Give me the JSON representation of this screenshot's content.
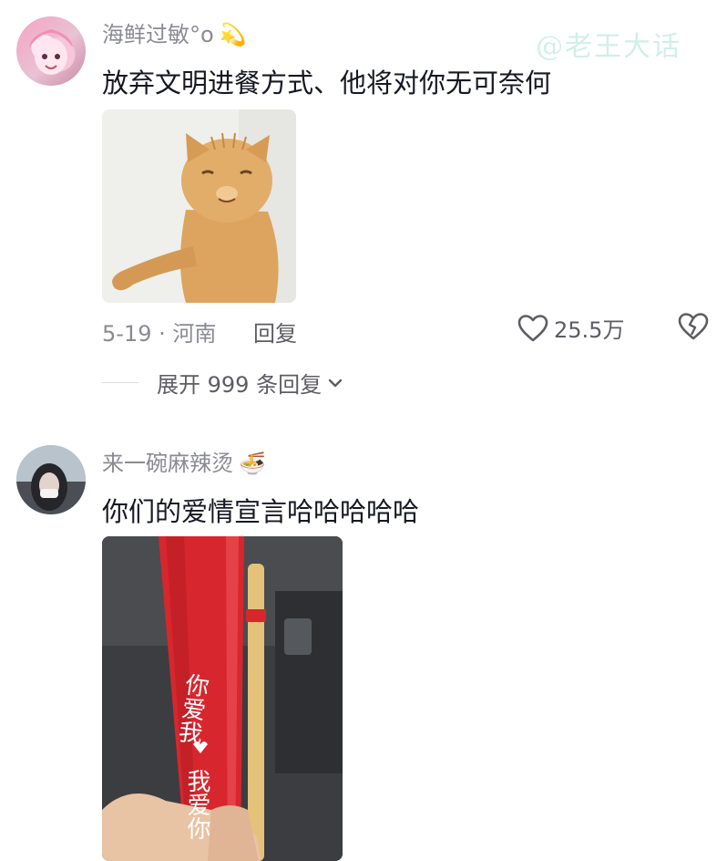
{
  "watermark": "@老王大话",
  "comments": [
    {
      "username": "海鲜过敏°o",
      "username_emoji": "💫",
      "text": "放弃文明进餐方式、他将对你无可奈何",
      "date_location": "5-19 · 河南",
      "reply_label": "回复",
      "like_count": "25.5万",
      "expand_label": "展开 999 条回复"
    },
    {
      "username": "来一碗麻辣烫",
      "username_emoji": "🍜",
      "text": "你们的爱情宣言哈哈哈哈哈",
      "media_text_top": "你爱我",
      "media_text_bottom": "我爱你"
    }
  ],
  "icons": {
    "like": "heart-outline-icon",
    "dislike": "broken-heart-icon",
    "expand": "chevron-down-icon"
  },
  "colors": {
    "text_primary": "#161823",
    "text_secondary": "#8a8b91",
    "action_text": "#5c5d62",
    "cup_red": "#d8262e"
  }
}
